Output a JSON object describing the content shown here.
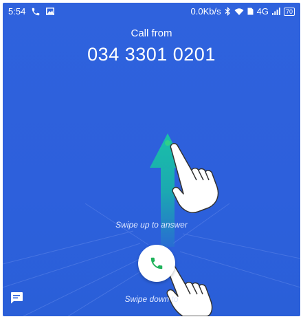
{
  "status_bar": {
    "time": "5:54",
    "network_speed": "0.0Kb/s",
    "network_type": "4G",
    "battery_level": "70"
  },
  "call": {
    "heading": "Call from",
    "number": "034 3301 0201"
  },
  "hints": {
    "swipe_up": "Swipe up to answer",
    "swipe_down": "Swipe down to"
  },
  "icons": {
    "status": [
      "phone-icon",
      "image-icon",
      "bluetooth-icon",
      "wifi-icon",
      "sim-icon",
      "signal-icon",
      "battery-icon"
    ],
    "answer": "phone-icon",
    "message": "message-icon"
  },
  "colors": {
    "background": "#2d60dc",
    "answer_icon": "#1fb35b",
    "arrow": "#16b4a8"
  }
}
